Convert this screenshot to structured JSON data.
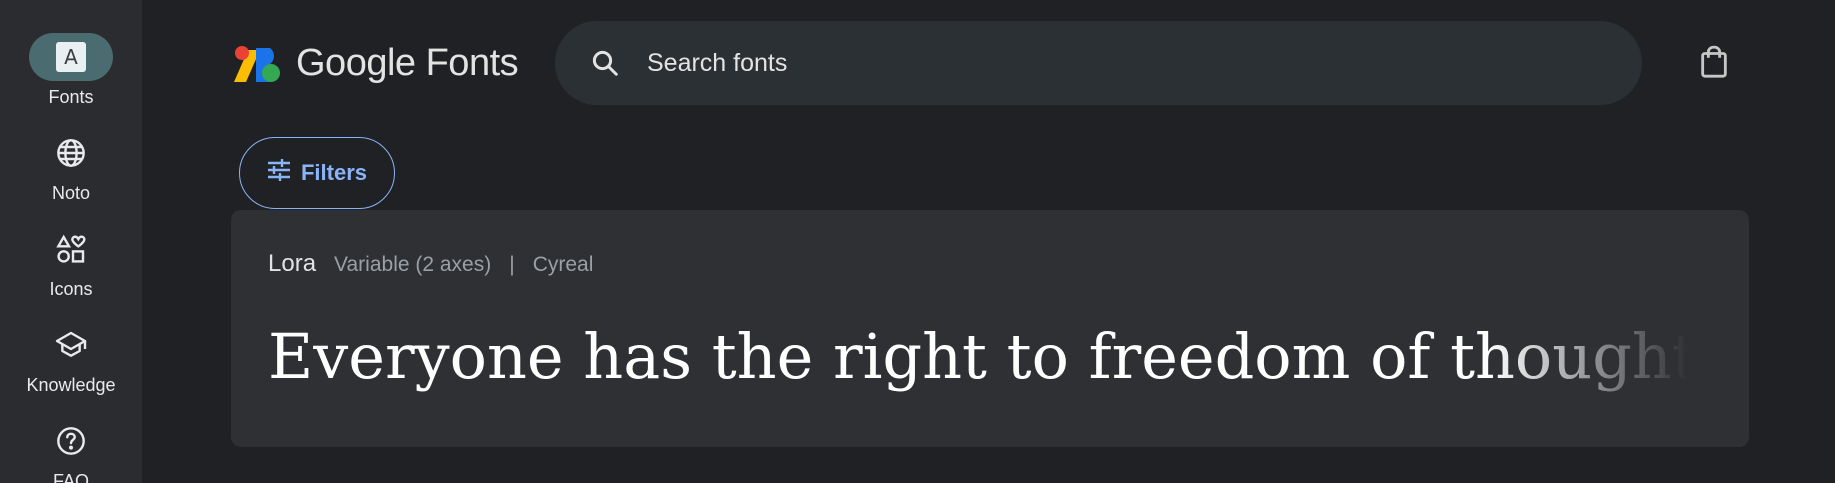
{
  "rail": {
    "items": [
      {
        "label": "Fonts",
        "icon": "font-icon",
        "glyph": "A",
        "active": true
      },
      {
        "label": "Noto",
        "icon": "globe-icon",
        "active": false
      },
      {
        "label": "Icons",
        "icon": "shapes-icon",
        "active": false
      },
      {
        "label": "Knowledge",
        "icon": "school-icon",
        "active": false
      },
      {
        "label": "FAQ",
        "icon": "help-icon",
        "active": false
      }
    ]
  },
  "header": {
    "brand": "Google Fonts",
    "search_placeholder": "Search fonts",
    "bag_icon": "shopping-bag-icon"
  },
  "filters": {
    "label": "Filters",
    "icon": "tune-icon"
  },
  "font_card": {
    "name": "Lora",
    "detail": "Variable (2 axes)",
    "separator": "|",
    "designer": "Cyreal",
    "preview_text": "Everyone has the right to freedom of thought, conscience and religion"
  },
  "colors": {
    "background": "#202124",
    "rail": "#2b2c2f",
    "active_pill": "#4a6b6f",
    "accent": "#8ab4f8",
    "card": "#2f3034"
  }
}
